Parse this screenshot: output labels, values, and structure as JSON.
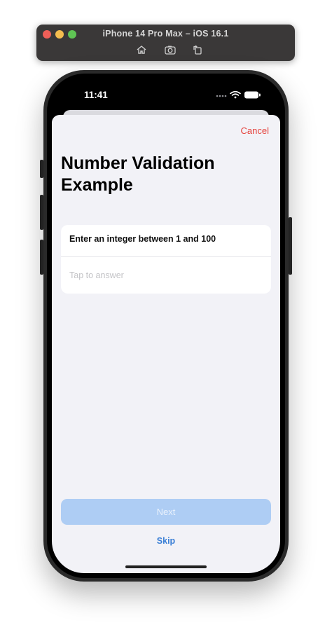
{
  "simulator": {
    "title": "iPhone 14 Pro Max – iOS 16.1",
    "toolbar": [
      "home-icon",
      "screenshot-icon",
      "rotate-icon"
    ]
  },
  "status_bar": {
    "time": "11:41",
    "icons": [
      "signal-dots-icon",
      "wifi-icon",
      "battery-icon"
    ]
  },
  "sheet": {
    "cancel_label": "Cancel",
    "title": "Number Validation Example",
    "question": {
      "label": "Enter an integer between 1 and 100",
      "placeholder": "Tap to answer",
      "value": ""
    },
    "next_label": "Next",
    "skip_label": "Skip"
  },
  "colors": {
    "cancel": "#e5413b",
    "next_disabled": "#aecdf4",
    "skip": "#3c80d6",
    "background": "#f2f2f7"
  }
}
